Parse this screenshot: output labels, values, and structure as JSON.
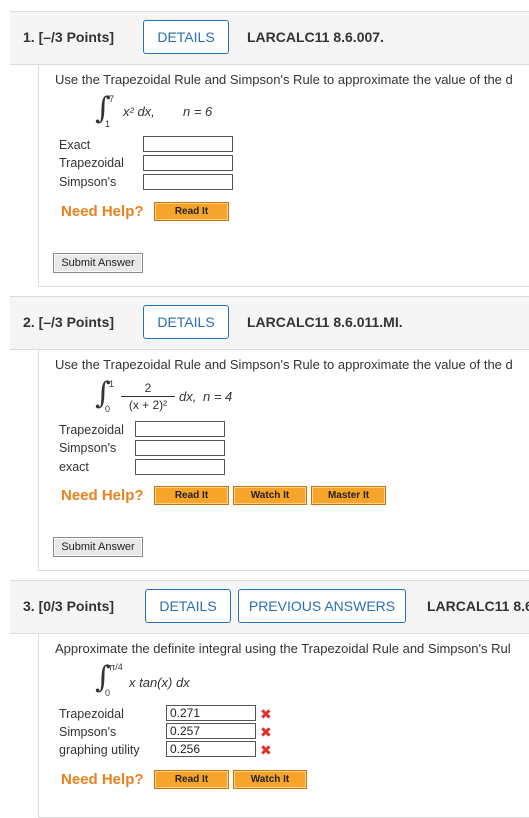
{
  "q1": {
    "number": "1. [–/3 Points]",
    "details": "DETAILS",
    "code": "LARCALC11 8.6.007.",
    "prompt": "Use the Trapezoidal Rule and Simpson's Rule to approximate the value of the d",
    "upper": "7",
    "lower": "1",
    "integrand": "x² dx,",
    "n": "n = 6",
    "labels": [
      "Exact",
      "Trapezoidal",
      "Simpson's"
    ],
    "need_help": "Need Help?",
    "read_it": "Read It",
    "submit": "Submit Answer"
  },
  "q2": {
    "number": "2. [–/3 Points]",
    "details": "DETAILS",
    "code": "LARCALC11 8.6.011.MI.",
    "prompt": "Use the Trapezoidal Rule and Simpson's Rule to approximate the value of the d",
    "upper": "1",
    "lower": "0",
    "numerator": "2",
    "denominator": "(x + 2)²",
    "rest": "dx,",
    "n": "n = 4",
    "labels": [
      "Trapezoidal",
      "Simpson's",
      "exact"
    ],
    "need_help": "Need Help?",
    "read_it": "Read It",
    "watch_it": "Watch It",
    "master_it": "Master It",
    "submit": "Submit Answer"
  },
  "q3": {
    "number": "3. [0/3 Points]",
    "details": "DETAILS",
    "previous": "PREVIOUS ANSWERS",
    "code": "LARCALC11 8.6",
    "prompt": "Approximate the definite integral using the Trapezoidal Rule and Simpson's Rul",
    "upper": "π/4",
    "lower": "0",
    "integrand": "x tan(x) dx",
    "labels": [
      "Trapezoidal",
      "Simpson's",
      "graphing utility"
    ],
    "values": [
      "0.271",
      "0.257",
      "0.256"
    ],
    "need_help": "Need Help?",
    "read_it": "Read It",
    "watch_it": "Watch It"
  },
  "colors": {
    "accent": "#2a6eb3",
    "help": "#e8821e",
    "button": "#f7a42a",
    "error": "#e03030"
  }
}
